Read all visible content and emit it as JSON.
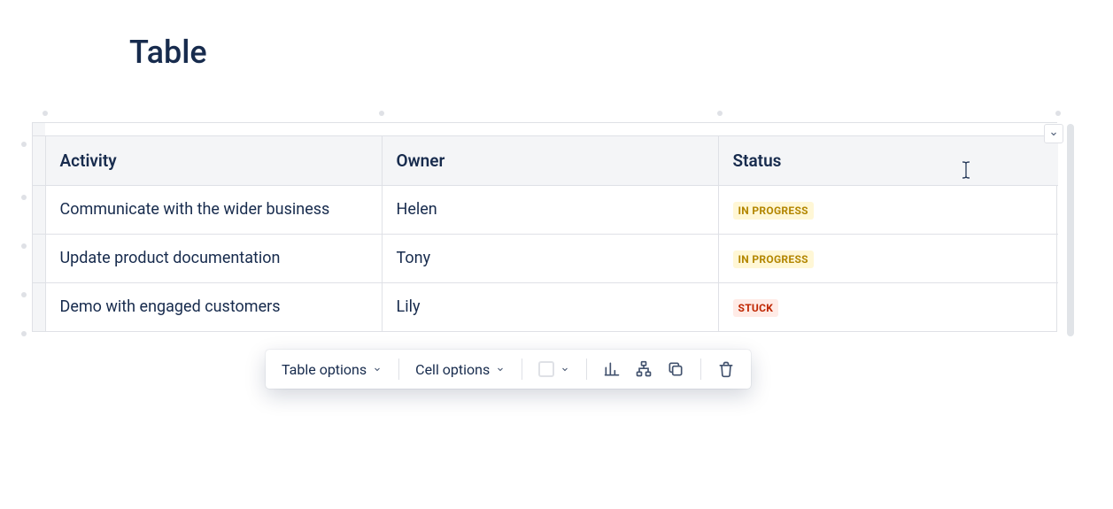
{
  "title": "Table",
  "columns": [
    "Activity",
    "Owner",
    "Status"
  ],
  "rows": [
    {
      "activity": "Communicate with the wider business",
      "owner": "Helen",
      "status": "IN PROGRESS",
      "status_kind": "inprogress"
    },
    {
      "activity": "Update product documentation",
      "owner": "Tony",
      "status": "IN PROGRESS",
      "status_kind": "inprogress"
    },
    {
      "activity": "Demo with engaged customers",
      "owner": "Lily",
      "status": "STUCK",
      "status_kind": "stuck"
    }
  ],
  "toolbar": {
    "table_options": "Table options",
    "cell_options": "Cell options"
  }
}
